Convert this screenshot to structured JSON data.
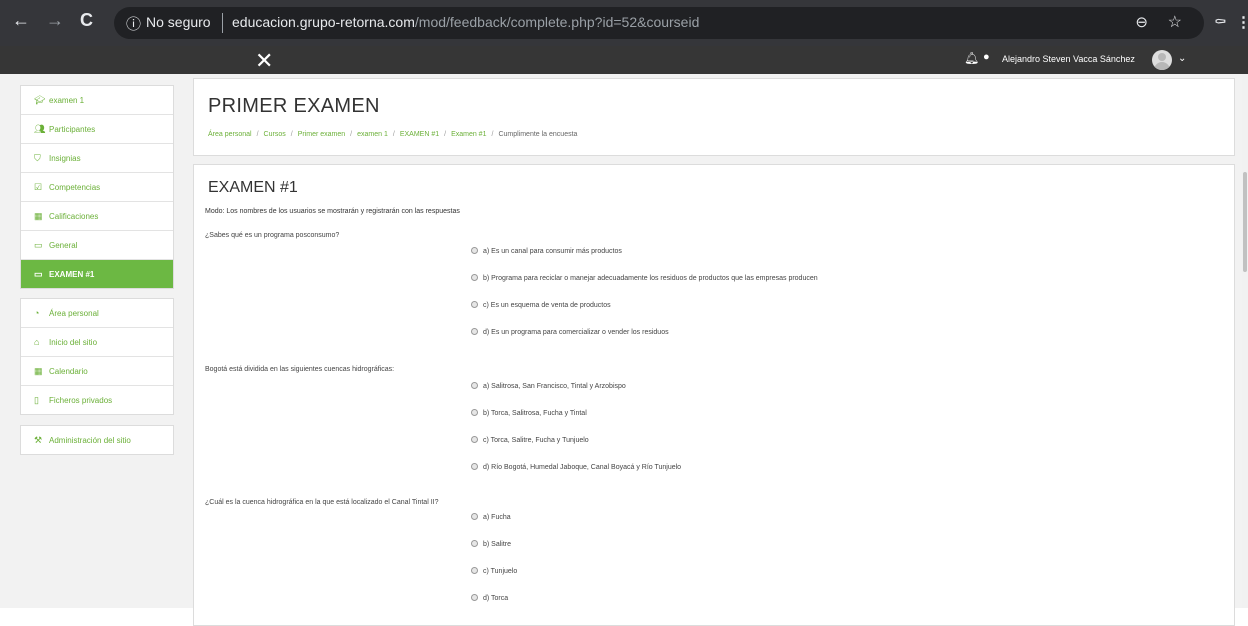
{
  "browser": {
    "security_label": "No seguro",
    "url_domain": "educacion.grupo-retorna.com",
    "url_path": "/mod/feedback/complete.php?id=52&courseid"
  },
  "topbar": {
    "close_glyph": "✕",
    "user_name": "Alejandro Steven Vacca Sánchez"
  },
  "sidebar": {
    "course_block": [
      {
        "label": "examen 1",
        "icon": "graduation-cap-icon"
      },
      {
        "label": "Participantes",
        "icon": "users-icon"
      },
      {
        "label": "Insignias",
        "icon": "shield-icon"
      },
      {
        "label": "Competencias",
        "icon": "check-square-icon"
      },
      {
        "label": "Calificaciones",
        "icon": "table-icon"
      },
      {
        "label": "General",
        "icon": "folder-icon"
      },
      {
        "label": "EXAMEN #1",
        "icon": "folder-icon",
        "active": true
      }
    ],
    "site_block": [
      {
        "label": "Área personal",
        "icon": "dashboard-icon"
      },
      {
        "label": "Inicio del sitio",
        "icon": "home-icon"
      },
      {
        "label": "Calendario",
        "icon": "calendar-icon"
      },
      {
        "label": "Ficheros privados",
        "icon": "file-icon"
      }
    ],
    "admin_block": [
      {
        "label": "Administración del sitio",
        "icon": "wrench-icon"
      }
    ]
  },
  "header": {
    "title": "PRIMER EXAMEN",
    "breadcrumb": [
      "Área personal",
      "Cursos",
      "Primer examen",
      "examen 1",
      "EXAMEN #1",
      "Examen #1",
      "Cumplimente la encuesta"
    ]
  },
  "exam": {
    "title": "EXAMEN #1",
    "mode": "Modo: Los nombres de los usuarios se mostrarán y registrarán con las respuestas",
    "questions": [
      {
        "text": "¿Sabes qué es un programa posconsumo?",
        "options": [
          "a) Es un canal para consumir más productos",
          "b) Programa para reciclar o manejar adecuadamente los residuos de productos que las empresas producen",
          "c) Es un esquema de venta de productos",
          "d) Es un programa para comercializar o vender los residuos"
        ]
      },
      {
        "text": "Bogotá está dividida en las siguientes cuencas hidrográficas:",
        "options": [
          "a) Salitrosa, San Francisco, Tintal y Arzobispo",
          "b) Torca, Salitrosa, Fucha y Tintal",
          "c) Torca, Salitre, Fucha y Tunjuelo",
          "d) Río Bogotá, Humedal Jaboque, Canal Boyacá y Río Tunjuelo"
        ]
      },
      {
        "text": "¿Cuál es la cuenca hidrográfica en la que está localizado el Canal Tintal II?",
        "options": [
          "a) Fucha",
          "b) Salitre",
          "c) Tunjuelo",
          "d) Torca"
        ]
      }
    ]
  }
}
